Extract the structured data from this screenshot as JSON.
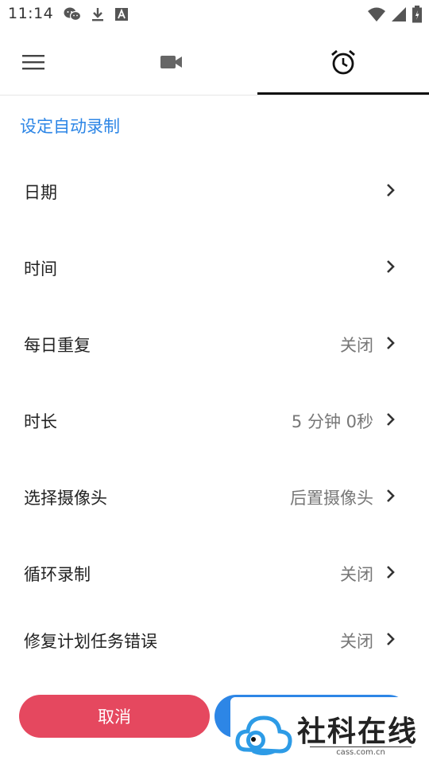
{
  "status_bar": {
    "time": "11:14",
    "left_icons": [
      "wechat-icon",
      "download-icon",
      "font-a-icon"
    ],
    "right_icons": [
      "wifi-icon",
      "signal-icon",
      "battery-icon"
    ]
  },
  "tabs": [
    {
      "icon": "menu-icon"
    },
    {
      "icon": "video-camera-icon"
    },
    {
      "icon": "alarm-clock-icon",
      "active": true
    }
  ],
  "section_title": "设定自动录制",
  "settings": [
    {
      "label": "日期",
      "value": ""
    },
    {
      "label": "时间",
      "value": ""
    },
    {
      "label": "每日重复",
      "value": "关闭"
    },
    {
      "label": "时长",
      "value": "5 分钟 0秒"
    },
    {
      "label": "选择摄像头",
      "value": "后置摄像头"
    },
    {
      "label": "循环录制",
      "value": "关闭"
    },
    {
      "label": "修复计划任务错误",
      "value": "关闭"
    }
  ],
  "buttons": {
    "cancel": "取消",
    "confirm": ""
  },
  "watermark": {
    "text": "社科在线",
    "url": "cass.com.cn"
  },
  "colors": {
    "accent": "#2d86e6",
    "cancel": "#e5485f"
  }
}
